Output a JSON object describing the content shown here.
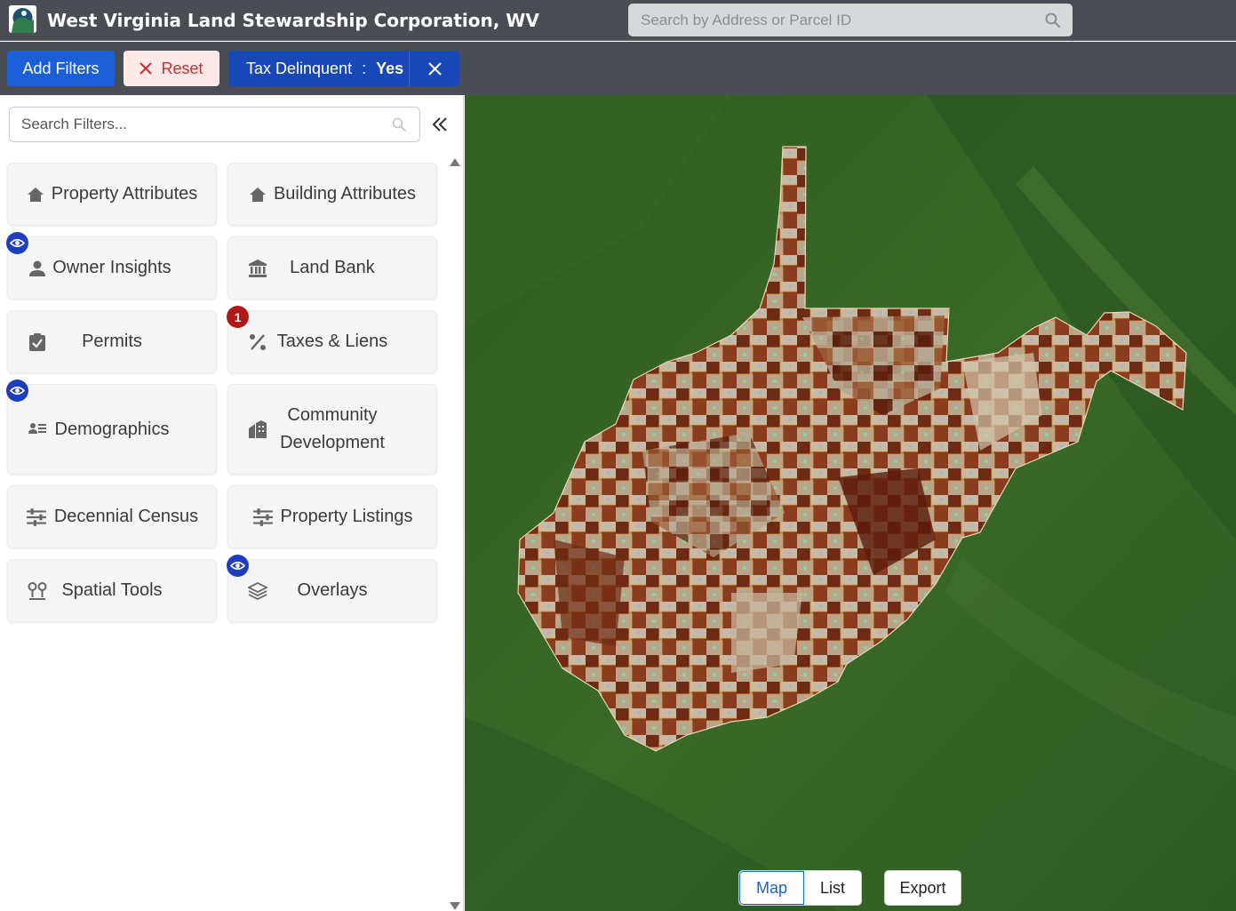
{
  "header": {
    "title": "West Virginia Land Stewardship Corporation, WV",
    "search_placeholder": "Search by Address or Parcel ID"
  },
  "filterbar": {
    "add_filters_label": "Add Filters",
    "reset_label": "Reset",
    "active_filter": {
      "name": "Tax Delinquent",
      "separator": ":",
      "value": "Yes"
    }
  },
  "panel": {
    "search_placeholder": "Search Filters...",
    "categories": [
      {
        "label": "Property Attributes",
        "icon": "home-icon"
      },
      {
        "label": "Building Attributes",
        "icon": "home-icon"
      },
      {
        "label": "Owner Insights",
        "icon": "person-icon",
        "visible_indicator": true
      },
      {
        "label": "Land Bank",
        "icon": "bank-icon"
      },
      {
        "label": "Permits",
        "icon": "clipboard-check-icon"
      },
      {
        "label": "Taxes & Liens",
        "icon": "percent-icon",
        "badge": "1"
      },
      {
        "label": "Demographics",
        "icon": "people-list-icon",
        "visible_indicator": true
      },
      {
        "label": "Community Development",
        "icon": "buildings-icon"
      },
      {
        "label": "Decennial Census",
        "icon": "sliders-icon"
      },
      {
        "label": "Property Listings",
        "icon": "sliders-icon"
      },
      {
        "label": "Spatial Tools",
        "icon": "map-pins-icon"
      },
      {
        "label": "Overlays",
        "icon": "layers-icon",
        "visible_indicator": true
      }
    ]
  },
  "map": {
    "view_options": [
      "Map",
      "List"
    ],
    "active_view": "Map",
    "export_label": "Export"
  },
  "colors": {
    "header_bg": "#4a4d53",
    "primary": "#1a5fd8",
    "chip": "#1848b8",
    "reset_bg": "#fde9e9",
    "reset_text": "#c43230",
    "eye_badge": "#1f3ebf",
    "count_badge": "#b01818"
  }
}
